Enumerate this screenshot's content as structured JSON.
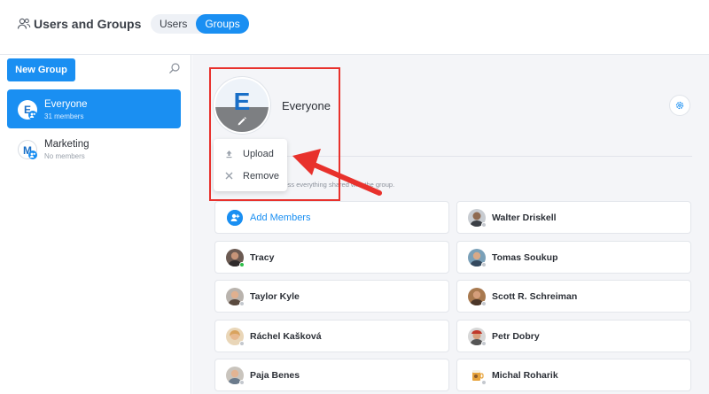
{
  "header": {
    "title": "Users and Groups",
    "tabs": [
      {
        "label": "Users",
        "active": false
      },
      {
        "label": "Groups",
        "active": true
      }
    ]
  },
  "sidebar": {
    "new_group_label": "New Group",
    "groups": [
      {
        "initial": "E",
        "name": "Everyone",
        "count": "31 members",
        "active": true
      },
      {
        "initial": "M",
        "name": "Marketing",
        "count": "No members",
        "active": false
      }
    ]
  },
  "main": {
    "group_initial": "E",
    "group_name": "Everyone",
    "description": "ccess everything shared with the group.",
    "menu": {
      "upload_label": "Upload",
      "remove_label": "Remove"
    },
    "add_members_label": "Add Members",
    "members": [
      {
        "name": "Walter Driskell",
        "status": "offline"
      },
      {
        "name": "Tracy",
        "status": "online"
      },
      {
        "name": "Tomas Soukup",
        "status": "offline"
      },
      {
        "name": "Taylor Kyle",
        "status": "offline"
      },
      {
        "name": "Scott R. Schreiman",
        "status": "offline"
      },
      {
        "name": "Ráchel Kašková",
        "status": "offline"
      },
      {
        "name": "Petr Dobry",
        "status": "offline"
      },
      {
        "name": "Paja Benes",
        "status": "offline"
      },
      {
        "name": "Michal Roharik",
        "status": "offline"
      }
    ]
  },
  "colors": {
    "accent": "#1a8ff2",
    "highlight": "#e8312c",
    "online": "#2fbf4a",
    "offline": "#c4c8ce"
  }
}
